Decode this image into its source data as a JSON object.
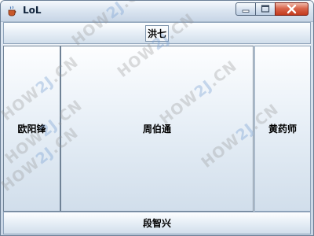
{
  "window": {
    "title": "LoL"
  },
  "icons": {
    "app": "java-cup-icon",
    "minimize": "minimize-icon",
    "maximize": "maximize-icon",
    "close": "close-icon"
  },
  "panels": {
    "north": "洪七",
    "west": "欧阳锋",
    "center": "周伯通",
    "east": "黄药师",
    "south": "段智兴"
  },
  "watermark": {
    "prefix": "HOW",
    "accent": "2J",
    "suffix": ".CN"
  }
}
